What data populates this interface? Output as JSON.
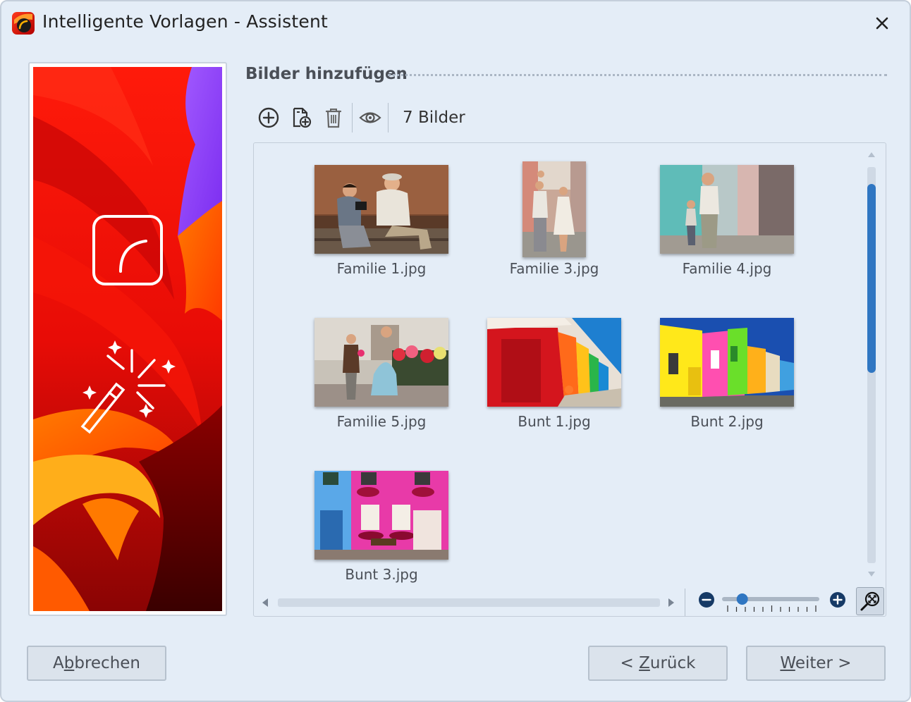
{
  "window": {
    "title": "Intelligente Vorlagen - Assistent",
    "accent_color": "#2f76c2"
  },
  "section": {
    "title": "Bilder hinzufügen"
  },
  "toolbar": {
    "count_label": "7 Bilder",
    "icons": [
      "add-icon",
      "add-file-icon",
      "trash-icon",
      "eye-icon"
    ]
  },
  "images": [
    {
      "name": "Familie 1.jpg"
    },
    {
      "name": "Familie 3.jpg"
    },
    {
      "name": "Familie 4.jpg"
    },
    {
      "name": "Familie 5.jpg"
    },
    {
      "name": "Bunt 1.jpg"
    },
    {
      "name": "Bunt 2.jpg"
    },
    {
      "name": "Bunt 3.jpg"
    }
  ],
  "zoom": {
    "level": 0.18
  },
  "buttons": {
    "cancel": {
      "pre": "A",
      "mnemonic": "b",
      "post": "brechen"
    },
    "back": {
      "pre": "< ",
      "mnemonic": "Z",
      "post": "urück"
    },
    "next": {
      "pre": "",
      "mnemonic": "W",
      "post": "eiter >"
    }
  }
}
